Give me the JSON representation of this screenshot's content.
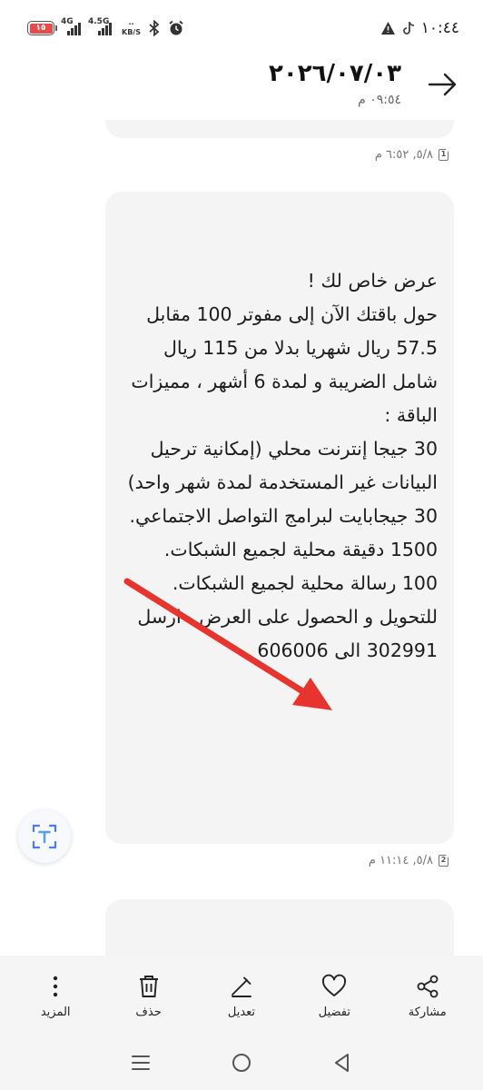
{
  "status_bar": {
    "time": "١٠:٤٤",
    "battery_level": "١٥",
    "network_1": "4G",
    "network_2": "4.5G",
    "speed_value": "··",
    "speed_unit": "KB/S",
    "icons": [
      "warning-icon",
      "tiktok-icon",
      "bluetooth-icon",
      "alarm-icon"
    ]
  },
  "header": {
    "title": "٢٠٢٦/٠٧/٠٣",
    "subtitle": "٠٩:٥٤ م"
  },
  "messages": [
    {
      "sim": "1",
      "timestamp": "٥/٨, ٦:٥٢ م"
    },
    {
      "sim": "2",
      "timestamp": "٥/٨, ١١:١٤ م",
      "body": "عرض خاص لك !\nحول باقتك الآن إلى مفوتر 100  مقابل 57.5 ريال شهريا بدلا من 115 ريال شامل الضريبة و لمدة 6 أشهر ، مميزات الباقة :\n30 جيجا إنترنت محلي  (إمكانية ترحيل البيانات غير المستخدمة لمدة شهر واحد)\n30 جيجابايت لبرامج التواصل الاجتماعي.\n1500 دقيقة محلية لجميع الشبكات.\n100 رسالة محلية لجميع الشبكات.\nللتحويل و الحصول على العرض ، ارسل 302991 الى 606006"
    }
  ],
  "toolbar": {
    "share": "مشاركة",
    "favorite": "تفضيل",
    "edit": "تعديل",
    "delete": "حذف",
    "more": "المزيد"
  },
  "colors": {
    "bubble": "#f4f4f4",
    "toolbar": "#f5f5f5",
    "annotation_arrow": "#e8342f",
    "translate_accent": "#4a7fe0"
  }
}
